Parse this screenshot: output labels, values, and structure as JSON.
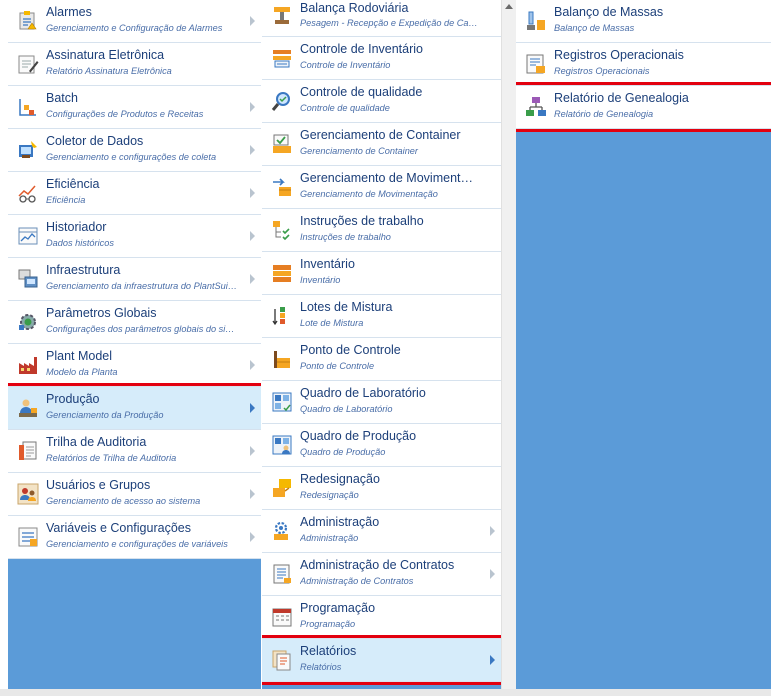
{
  "col1": {
    "items": [
      {
        "label": "Alarmes",
        "sub": "Gerenciamento e Configuração de Alarmes",
        "icon": "alarm-icon"
      },
      {
        "label": "Assinatura Eletrônica",
        "sub": "Relatório Assinatura Eletrônica",
        "icon": "signature-icon"
      },
      {
        "label": "Batch",
        "sub": "Configurações de Produtos e Receitas",
        "icon": "batch-icon"
      },
      {
        "label": "Coletor de Dados",
        "sub": "Gerenciamento e configurações de coleta",
        "icon": "data-collector-icon"
      },
      {
        "label": "Eficiência",
        "sub": "Eficiência",
        "icon": "efficiency-icon"
      },
      {
        "label": "Historiador",
        "sub": "Dados históricos",
        "icon": "historian-icon"
      },
      {
        "label": "Infraestrutura",
        "sub": "Gerenciamento da infraestrutura do PlantSuite ...",
        "icon": "infrastructure-icon"
      },
      {
        "label": "Parâmetros Globais",
        "sub": "Configurações dos parâmetros globais do siste...",
        "icon": "global-params-icon"
      },
      {
        "label": "Plant Model",
        "sub": "Modelo da Planta",
        "icon": "plant-model-icon"
      },
      {
        "label": "Produção",
        "sub": "Gerenciamento da Produção",
        "icon": "production-icon"
      },
      {
        "label": "Trilha de Auditoria",
        "sub": "Relatórios de Trilha de Auditoria",
        "icon": "audit-trail-icon"
      },
      {
        "label": "Usuários e Grupos",
        "sub": "Gerenciamento de acesso ao sistema",
        "icon": "users-groups-icon"
      },
      {
        "label": "Variáveis e Configurações",
        "sub": "Gerenciamento e configurações de variáveis",
        "icon": "variables-icon"
      }
    ]
  },
  "col2": {
    "items": [
      {
        "label": "Balança Rodoviária",
        "sub": "Pesagem - Recepção e Expedição de Caminhões",
        "icon": "truck-scale-icon"
      },
      {
        "label": "Controle de Inventário",
        "sub": "Controle de Inventário",
        "icon": "inventory-control-icon"
      },
      {
        "label": "Controle de qualidade",
        "sub": "Controle de qualidade",
        "icon": "quality-control-icon"
      },
      {
        "label": "Gerenciamento de Container",
        "sub": "Gerenciamento de Container",
        "icon": "container-icon"
      },
      {
        "label": "Gerenciamento de Movimentação",
        "sub": "Gerenciamento de Movimentação",
        "icon": "movement-icon"
      },
      {
        "label": "Instruções de trabalho",
        "sub": "Instruções de trabalho",
        "icon": "work-instructions-icon"
      },
      {
        "label": "Inventário",
        "sub": "Inventário",
        "icon": "inventory-icon"
      },
      {
        "label": "Lotes de Mistura",
        "sub": "Lote de Mistura",
        "icon": "mix-lots-icon"
      },
      {
        "label": "Ponto de Controle",
        "sub": "Ponto de Controle",
        "icon": "checkpoint-icon"
      },
      {
        "label": "Quadro de Laboratório",
        "sub": "Quadro de Laboratório",
        "icon": "lab-board-icon"
      },
      {
        "label": "Quadro de Produção",
        "sub": "Quadro de Produção",
        "icon": "production-board-icon"
      },
      {
        "label": "Redesignação",
        "sub": "Redesignação",
        "icon": "reassignment-icon"
      },
      {
        "label": "Administração",
        "sub": "Administração",
        "icon": "admin-gear-icon"
      },
      {
        "label": "Administração de Contratos",
        "sub": "Administração de Contratos",
        "icon": "contracts-icon"
      },
      {
        "label": "Programação",
        "sub": "Programação",
        "icon": "schedule-icon"
      },
      {
        "label": "Relatórios",
        "sub": "Relatórios",
        "icon": "reports-icon"
      }
    ]
  },
  "col3": {
    "items": [
      {
        "label": "Balanço de Massas",
        "sub": "Balanço de Massas",
        "icon": "mass-balance-icon"
      },
      {
        "label": "Registros Operacionais",
        "sub": "Registros Operacionais",
        "icon": "operational-records-icon"
      },
      {
        "label": "Relatório de Genealogia",
        "sub": "Relatório de Genealogia",
        "icon": "genealogy-icon"
      }
    ]
  },
  "colors": {
    "background_panel": "#5b9bd8",
    "item_label": "#1c3f79",
    "item_sub": "#4a6ea8",
    "selected_bg": "#d6ecfa",
    "highlight_border": "#e3000f"
  }
}
